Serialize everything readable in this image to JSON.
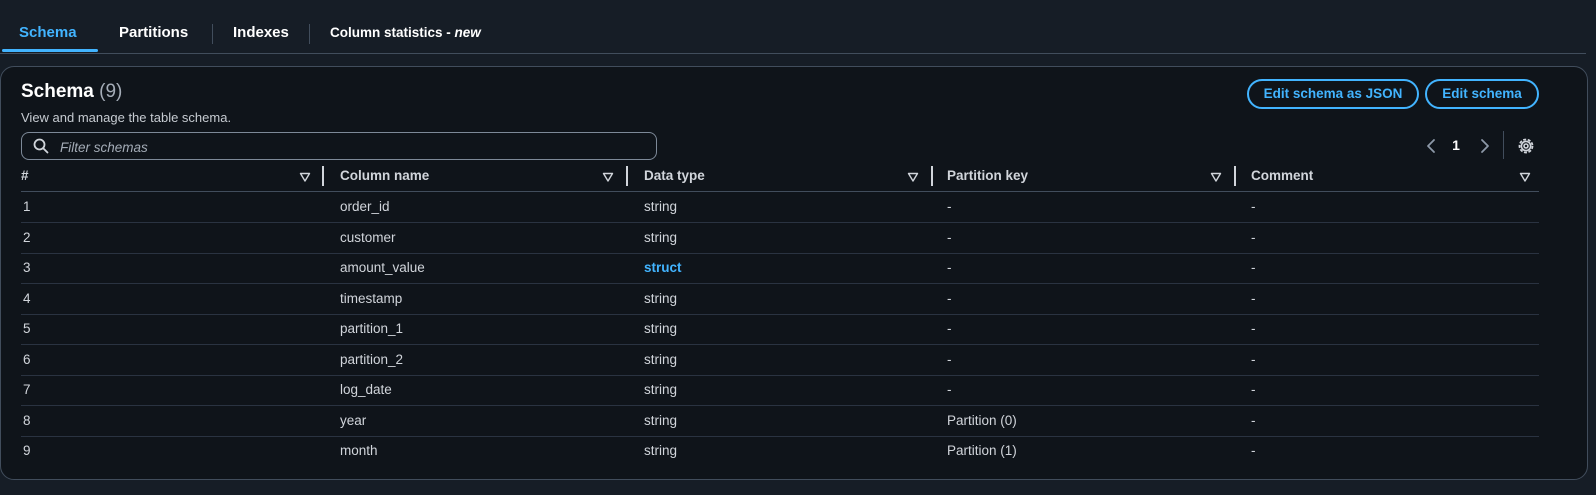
{
  "tabs": [
    {
      "label": "Schema"
    },
    {
      "label": "Partitions"
    },
    {
      "label": "Indexes"
    },
    {
      "label": "Column statistics - ",
      "suffix": "new"
    }
  ],
  "panel": {
    "title": "Schema",
    "count": "(9)",
    "description": "View and manage the table schema.",
    "buttons": {
      "edit_json": "Edit schema as JSON",
      "edit": "Edit schema"
    },
    "filter": {
      "placeholder": "Filter schemas",
      "value": ""
    },
    "pagination": {
      "current": "1"
    }
  },
  "table": {
    "columns": [
      "#",
      "Column name",
      "Data type",
      "Partition key",
      "Comment"
    ],
    "rows": [
      {
        "num": "1",
        "name": "order_id",
        "type": "string",
        "partition": "-",
        "comment": "-"
      },
      {
        "num": "2",
        "name": "customer",
        "type": "string",
        "partition": "-",
        "comment": "-"
      },
      {
        "num": "3",
        "name": "amount_value",
        "type": "struct",
        "partition": "-",
        "comment": "-"
      },
      {
        "num": "4",
        "name": "timestamp",
        "type": "string",
        "partition": "-",
        "comment": "-"
      },
      {
        "num": "5",
        "name": "partition_1",
        "type": "string",
        "partition": "-",
        "comment": "-"
      },
      {
        "num": "6",
        "name": "partition_2",
        "type": "string",
        "partition": "-",
        "comment": "-"
      },
      {
        "num": "7",
        "name": "log_date",
        "type": "string",
        "partition": "-",
        "comment": "-"
      },
      {
        "num": "8",
        "name": "year",
        "type": "string",
        "partition": "Partition (0)",
        "comment": "-"
      },
      {
        "num": "9",
        "name": "month",
        "type": "string",
        "partition": "Partition (1)",
        "comment": "-"
      }
    ]
  },
  "colors": {
    "accent": "#42b4ff",
    "background": "#0f141a",
    "border": "#414d5c",
    "text": "#d1d5db"
  },
  "icons": {
    "search": "search-icon",
    "prev": "chevron-left-icon",
    "next": "chevron-right-icon",
    "settings": "gear-icon",
    "sort": "caret-down-icon"
  }
}
